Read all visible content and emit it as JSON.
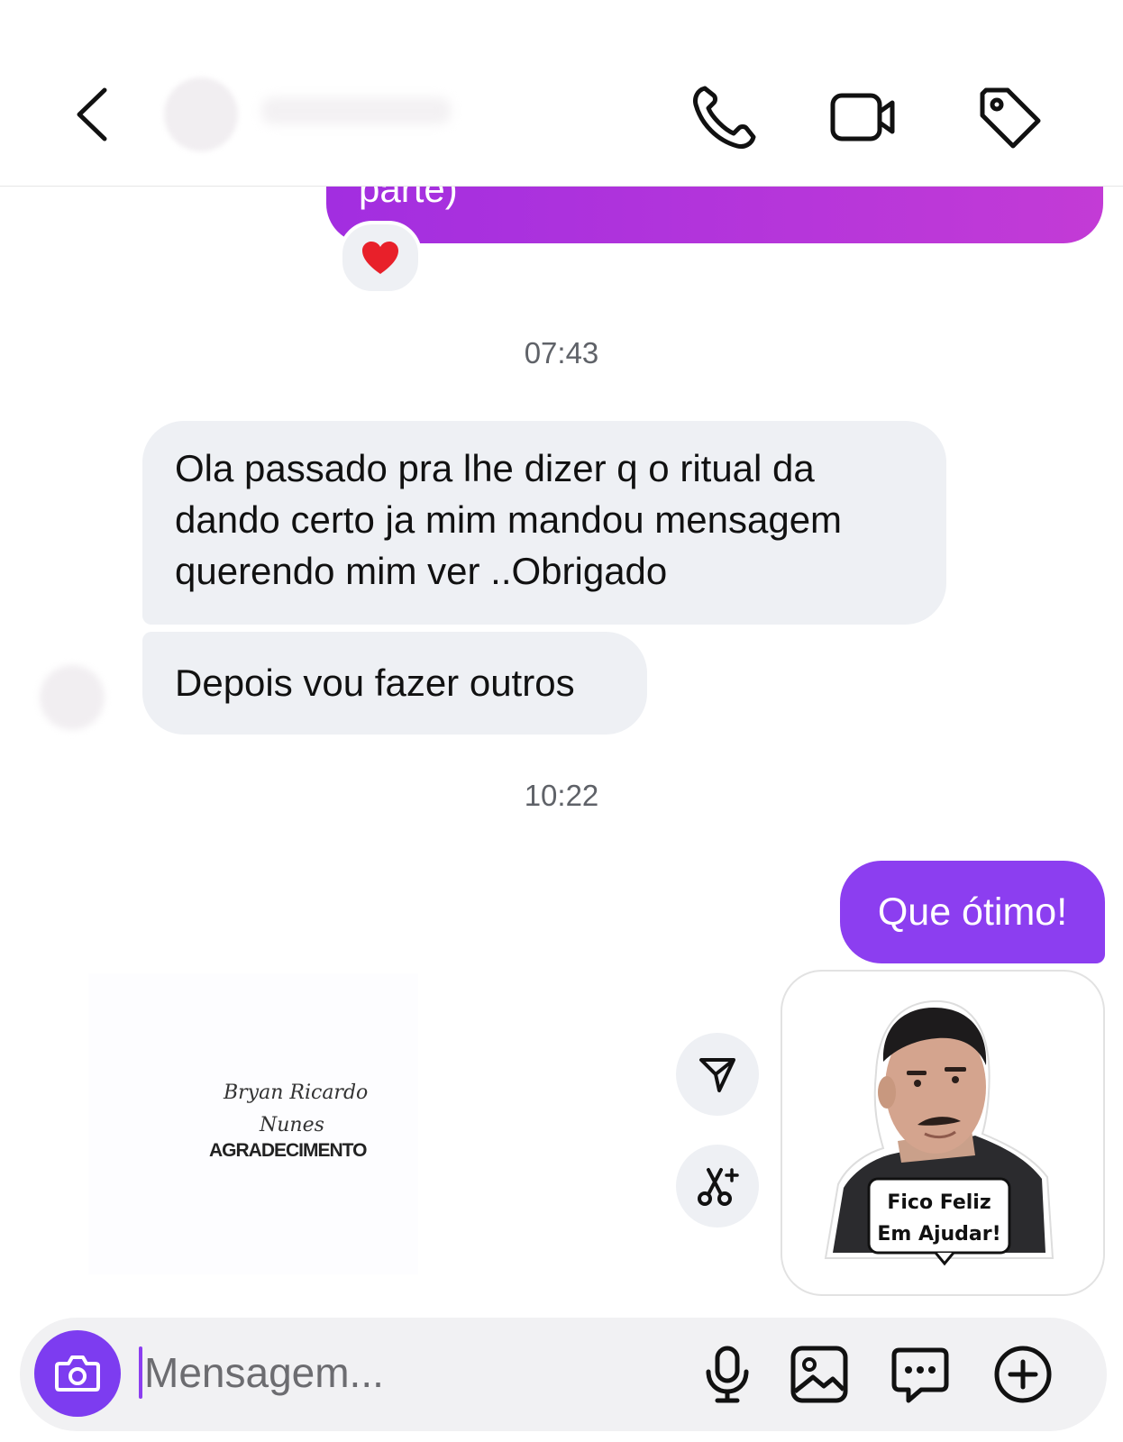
{
  "header": {
    "back_icon": "chevron-left-icon",
    "actions": [
      "phone-icon",
      "video-camera-icon",
      "tag-icon"
    ]
  },
  "thread": {
    "outgoing_partial": {
      "text": "parte)",
      "reaction": "❤️"
    },
    "timestamp_1": "07:43",
    "incoming_1": [
      "Ola passado pra lhe dizer q o ritual da",
      "dando certo ja mim mandou mensagem",
      "querendo mim ver ..Obrigado"
    ],
    "incoming_2": "Depois vou fazer outros",
    "timestamp_2": "10:22",
    "outgoing_1": "Que ótimo!",
    "sticker": {
      "caption_line1": "Fico Feliz",
      "caption_line2": "Em Ajudar!"
    },
    "sticker_actions": [
      "paper-plane-icon",
      "scissors-sparkle-icon"
    ]
  },
  "watermark": {
    "name_line1": "Bryan Ricardo",
    "name_line2": "Nunes",
    "title": "AGRADECIMENTO"
  },
  "composer": {
    "placeholder": "Mensagem...",
    "icons": [
      "camera-icon",
      "microphone-icon",
      "gallery-icon",
      "chat-bubble-icon",
      "plus-circle-icon"
    ]
  },
  "colors": {
    "accent_purple": "#8c3ef0",
    "bubble_gradient_start": "#a22ee0",
    "bubble_gradient_end": "#c33bd6",
    "incoming_bubble": "#eef0f4"
  }
}
